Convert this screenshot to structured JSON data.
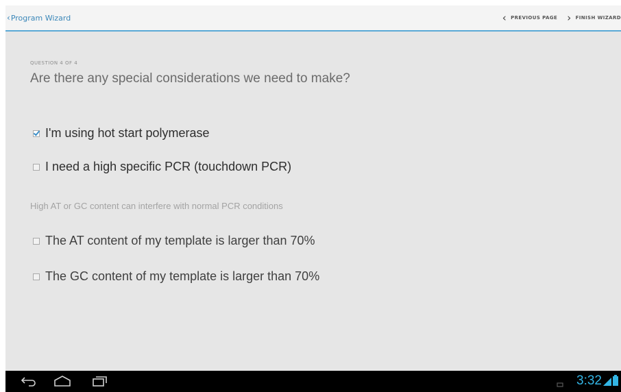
{
  "header": {
    "back_label": "Program Wizard",
    "previous_label": "PREVIOUS PAGE",
    "finish_label": "FINISH WIZARD"
  },
  "question": {
    "counter": "QUESTION 4 OF 4",
    "text": "Are there any special considerations we need to make?"
  },
  "options": [
    {
      "label": "I'm using hot start polymerase",
      "checked": true
    },
    {
      "label": "I need a high specific PCR (touchdown PCR)",
      "checked": false
    }
  ],
  "hint": "High AT or GC content can interfere with normal PCR conditions",
  "content_options": [
    {
      "label": "The AT content of my template is larger than 70%",
      "checked": false
    },
    {
      "label": "The GC content of my template is larger than 70%",
      "checked": false
    }
  ],
  "system_bar": {
    "time": "3:32",
    "icons": [
      "back-icon",
      "home-icon",
      "recent-apps-icon",
      "notification-icon",
      "wifi-icon",
      "battery-icon"
    ],
    "accent_color": "#33b5e5"
  },
  "colors": {
    "link": "#3b87b9",
    "divider": "#5aa9d6",
    "check": "#3c8fc8"
  }
}
